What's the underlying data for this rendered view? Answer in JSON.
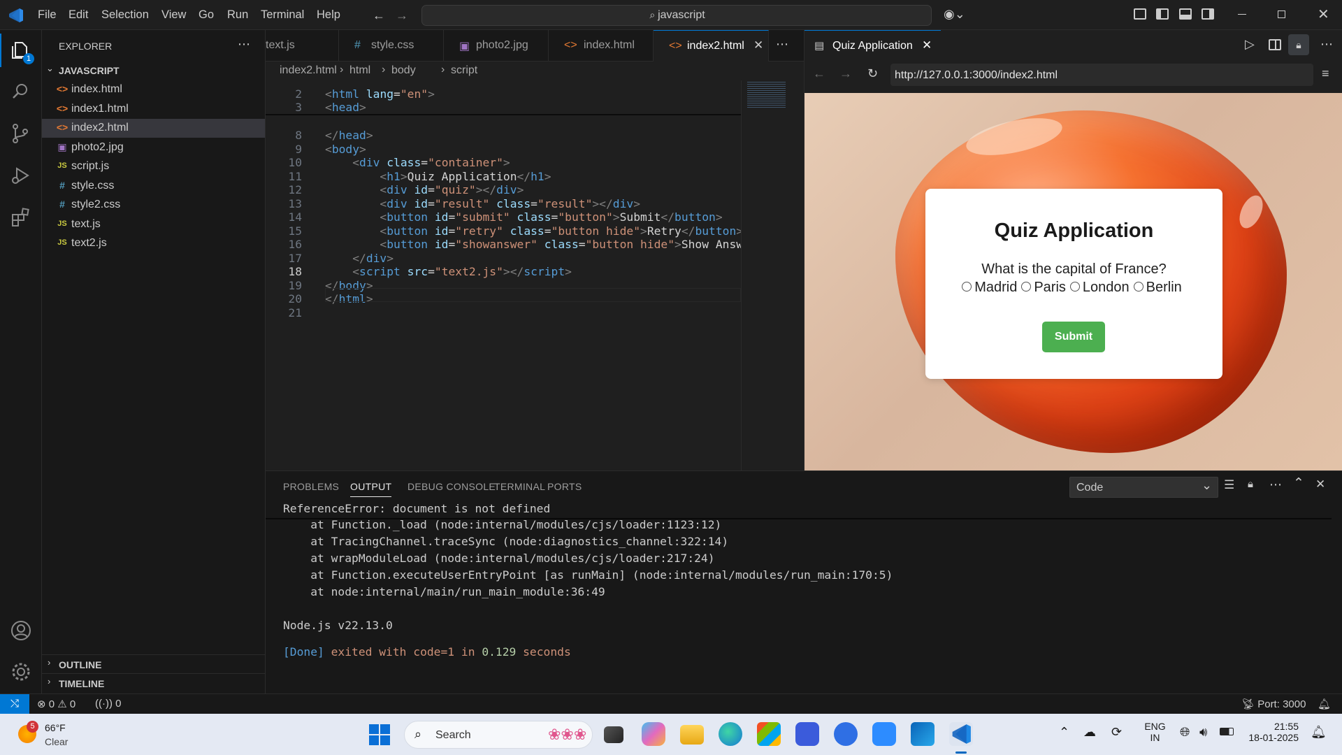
{
  "menu": [
    "File",
    "Edit",
    "Selection",
    "View",
    "Go",
    "Run",
    "Terminal",
    "Help"
  ],
  "search": {
    "text": "javascript"
  },
  "activity": {
    "explorer_badge": "1"
  },
  "explorer": {
    "title": "EXPLORER",
    "folder": "JAVASCRIPT",
    "files": [
      {
        "name": "index.html",
        "type": "html",
        "icon": "<>"
      },
      {
        "name": "index1.html",
        "type": "html",
        "icon": "<>"
      },
      {
        "name": "index2.html",
        "type": "html",
        "icon": "<>"
      },
      {
        "name": "photo2.jpg",
        "type": "image",
        "icon": "▣"
      },
      {
        "name": "script.js",
        "type": "js",
        "icon": "JS"
      },
      {
        "name": "style.css",
        "type": "css",
        "icon": "#"
      },
      {
        "name": "style2.css",
        "type": "css",
        "icon": "#"
      },
      {
        "name": "text.js",
        "type": "js",
        "icon": "JS"
      },
      {
        "name": "text2.js",
        "type": "js",
        "icon": "JS"
      }
    ],
    "outline": "OUTLINE",
    "timeline": "TIMELINE"
  },
  "editor": {
    "tabs": [
      "text.js",
      "style.css",
      "photo2.jpg",
      "index.html",
      "index2.html"
    ],
    "tab_icons": [
      "",
      "#",
      "▣",
      "<>",
      "<>"
    ],
    "breadcrumb": [
      "index2.html",
      "html",
      "body",
      "script"
    ]
  },
  "code_lines": [
    {
      "n": "2",
      "parts": [
        [
          "tg",
          "<"
        ],
        [
          "tn",
          "html"
        ],
        [
          "at",
          " lang"
        ],
        [
          "tx",
          "="
        ],
        [
          "sv",
          "\"en\""
        ],
        [
          "tg",
          ">"
        ]
      ]
    },
    {
      "n": "3",
      "parts": [
        [
          "tg",
          "<"
        ],
        [
          "tn",
          "head"
        ],
        [
          "tg",
          ">"
        ]
      ]
    },
    {
      "n": "8",
      "parts": [
        [
          "tg",
          "</"
        ],
        [
          "tn",
          "head"
        ],
        [
          "tg",
          ">"
        ]
      ]
    },
    {
      "n": "9",
      "parts": [
        [
          "tg",
          "<"
        ],
        [
          "tn",
          "body"
        ],
        [
          "tg",
          ">"
        ]
      ]
    },
    {
      "n": "10",
      "parts": [
        [
          "tx",
          "    "
        ],
        [
          "tg",
          "<"
        ],
        [
          "tn",
          "div"
        ],
        [
          "at",
          " class"
        ],
        [
          "tx",
          "="
        ],
        [
          "sv",
          "\"container\""
        ],
        [
          "tg",
          ">"
        ]
      ]
    },
    {
      "n": "11",
      "parts": [
        [
          "tx",
          "        "
        ],
        [
          "tg",
          "<"
        ],
        [
          "tn",
          "h1"
        ],
        [
          "tg",
          ">"
        ],
        [
          "tx",
          "Quiz Application"
        ],
        [
          "tg",
          "</"
        ],
        [
          "tn",
          "h1"
        ],
        [
          "tg",
          ">"
        ]
      ]
    },
    {
      "n": "12",
      "parts": [
        [
          "tx",
          "        "
        ],
        [
          "tg",
          "<"
        ],
        [
          "tn",
          "div"
        ],
        [
          "at",
          " id"
        ],
        [
          "tx",
          "="
        ],
        [
          "sv",
          "\"quiz\""
        ],
        [
          "tg",
          "></"
        ],
        [
          "tn",
          "div"
        ],
        [
          "tg",
          ">"
        ]
      ]
    },
    {
      "n": "13",
      "parts": [
        [
          "tx",
          "        "
        ],
        [
          "tg",
          "<"
        ],
        [
          "tn",
          "div"
        ],
        [
          "at",
          " id"
        ],
        [
          "tx",
          "="
        ],
        [
          "sv",
          "\"result\""
        ],
        [
          "at",
          " class"
        ],
        [
          "tx",
          "="
        ],
        [
          "sv",
          "\"result\""
        ],
        [
          "tg",
          "></"
        ],
        [
          "tn",
          "div"
        ],
        [
          "tg",
          ">"
        ]
      ]
    },
    {
      "n": "14",
      "parts": [
        [
          "tx",
          "        "
        ],
        [
          "tg",
          "<"
        ],
        [
          "tn",
          "button"
        ],
        [
          "at",
          " id"
        ],
        [
          "tx",
          "="
        ],
        [
          "sv",
          "\"submit\""
        ],
        [
          "at",
          " class"
        ],
        [
          "tx",
          "="
        ],
        [
          "sv",
          "\"button\""
        ],
        [
          "tg",
          ">"
        ],
        [
          "tx",
          "Submit"
        ],
        [
          "tg",
          "</"
        ],
        [
          "tn",
          "button"
        ],
        [
          "tg",
          ">"
        ]
      ]
    },
    {
      "n": "15",
      "parts": [
        [
          "tx",
          "        "
        ],
        [
          "tg",
          "<"
        ],
        [
          "tn",
          "button"
        ],
        [
          "at",
          " id"
        ],
        [
          "tx",
          "="
        ],
        [
          "sv",
          "\"retry\""
        ],
        [
          "at",
          " class"
        ],
        [
          "tx",
          "="
        ],
        [
          "sv",
          "\"button hide\""
        ],
        [
          "tg",
          ">"
        ],
        [
          "tx",
          "Retry"
        ],
        [
          "tg",
          "</"
        ],
        [
          "tn",
          "button"
        ],
        [
          "tg",
          ">"
        ]
      ]
    },
    {
      "n": "16",
      "parts": [
        [
          "tx",
          "        "
        ],
        [
          "tg",
          "<"
        ],
        [
          "tn",
          "button"
        ],
        [
          "at",
          " id"
        ],
        [
          "tx",
          "="
        ],
        [
          "sv",
          "\"showanswer\""
        ],
        [
          "at",
          " class"
        ],
        [
          "tx",
          "="
        ],
        [
          "sv",
          "\"button hide\""
        ],
        [
          "tg",
          ">"
        ],
        [
          "tx",
          "Show Answe"
        ]
      ]
    },
    {
      "n": "17",
      "parts": [
        [
          "tx",
          "    "
        ],
        [
          "tg",
          "</"
        ],
        [
          "tn",
          "div"
        ],
        [
          "tg",
          ">"
        ]
      ]
    },
    {
      "n": "18",
      "parts": [
        [
          "tx",
          "    "
        ],
        [
          "tg",
          "<"
        ],
        [
          "tn",
          "script"
        ],
        [
          "at",
          " src"
        ],
        [
          "tx",
          "="
        ],
        [
          "sv",
          "\"text2.js\""
        ],
        [
          "tg",
          "></"
        ],
        [
          "tn",
          "script"
        ],
        [
          "tg",
          ">"
        ]
      ]
    },
    {
      "n": "19",
      "parts": [
        [
          "tg",
          "</"
        ],
        [
          "tn",
          "body"
        ],
        [
          "tg",
          ">"
        ]
      ]
    },
    {
      "n": "20",
      "parts": [
        [
          "tg",
          "</"
        ],
        [
          "tn",
          "html"
        ],
        [
          "tg",
          ">"
        ]
      ]
    },
    {
      "n": "21",
      "parts": []
    }
  ],
  "browser": {
    "tab_title": "Quiz Application",
    "url": "http://127.0.0.1:3000/index2.html",
    "quiz": {
      "title": "Quiz Application",
      "question": "What is the capital of France?",
      "options": [
        "Madrid",
        "Paris",
        "London",
        "Berlin"
      ],
      "submit_label": "Submit",
      "submit_color": "#4caf50"
    }
  },
  "panel": {
    "tabs": [
      "PROBLEMS",
      "OUTPUT",
      "DEBUG CONSOLE",
      "TERMINAL",
      "PORTS"
    ],
    "active_tab": "OUTPUT",
    "channel": "Code",
    "sticky_line": "ReferenceError: document is not defined",
    "lines": [
      "    at Function._load (node:internal/modules/cjs/loader:1123:12)",
      "    at TracingChannel.traceSync (node:diagnostics_channel:322:14)",
      "    at wrapModuleLoad (node:internal/modules/cjs/loader:217:24)",
      "    at Function.executeUserEntryPoint [as runMain] (node:internal/modules/run_main:170:5)",
      "    at node:internal/main/run_main_module:36:49",
      "",
      "Node.js v22.13.0",
      ""
    ],
    "done": {
      "tag": "[Done]",
      "a": " exited with ",
      "code": "code=1",
      "b": " in ",
      "secs": "0.129",
      "c": " seconds"
    }
  },
  "status": {
    "errors": "0",
    "warnings": "0",
    "ports_fwd": "0",
    "port": "Port: 3000"
  },
  "taskbar": {
    "weather_temp": "66°F",
    "weather_desc": "Clear",
    "weather_badge": "5",
    "search": "Search",
    "lang1": "ENG",
    "lang2": "IN",
    "time": "21:55",
    "date": "18-01-2025"
  }
}
